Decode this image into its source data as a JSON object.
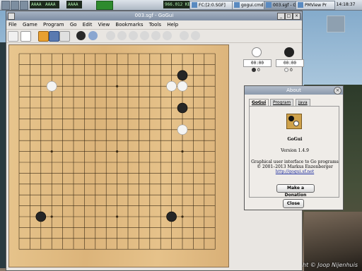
{
  "taskbar": {
    "widgets": [
      "AAAA",
      "AAAA",
      "AAAA"
    ],
    "meter_value": "966.012 KB",
    "tasks": [
      {
        "label": "FC:[2:0.SGF]"
      },
      {
        "label": "gogui.cmd"
      },
      {
        "label": "003.sgf - Go"
      },
      {
        "label": "PMView Pr"
      }
    ],
    "clock": "14:18:37"
  },
  "window": {
    "title": "003.sgf - GoGui",
    "menu": [
      "File",
      "Game",
      "Program",
      "Go",
      "Edit",
      "View",
      "Bookmarks",
      "Tools",
      "Help"
    ]
  },
  "board": {
    "size": 19,
    "stones": [
      {
        "col": 15,
        "row": 2,
        "color": "black"
      },
      {
        "col": 3,
        "row": 3,
        "color": "white"
      },
      {
        "col": 14,
        "row": 3,
        "color": "white"
      },
      {
        "col": 15,
        "row": 3,
        "color": "white"
      },
      {
        "col": 15,
        "row": 5,
        "color": "black"
      },
      {
        "col": 15,
        "row": 7,
        "color": "white"
      },
      {
        "col": 2,
        "row": 15,
        "color": "black"
      },
      {
        "col": 14,
        "row": 15,
        "color": "black"
      }
    ]
  },
  "panel": {
    "white_clock": "00:00",
    "black_clock": "00:00",
    "white_captures": "0",
    "black_captures": "0"
  },
  "about": {
    "title": "About",
    "tabs": [
      "GoGui",
      "Program",
      "Java"
    ],
    "app_name": "GoGui",
    "version": "Version 1.4.9",
    "description": "Graphical user interface to Go programs",
    "copyright": "© 2001–2013 Markus Enzenberger",
    "link": "http://gogui.sf.net",
    "donate_label": "Make a Donation",
    "close_label": "Close"
  },
  "desktop": {
    "copyright_text": "Copyright © Joop Nijenhuis"
  }
}
